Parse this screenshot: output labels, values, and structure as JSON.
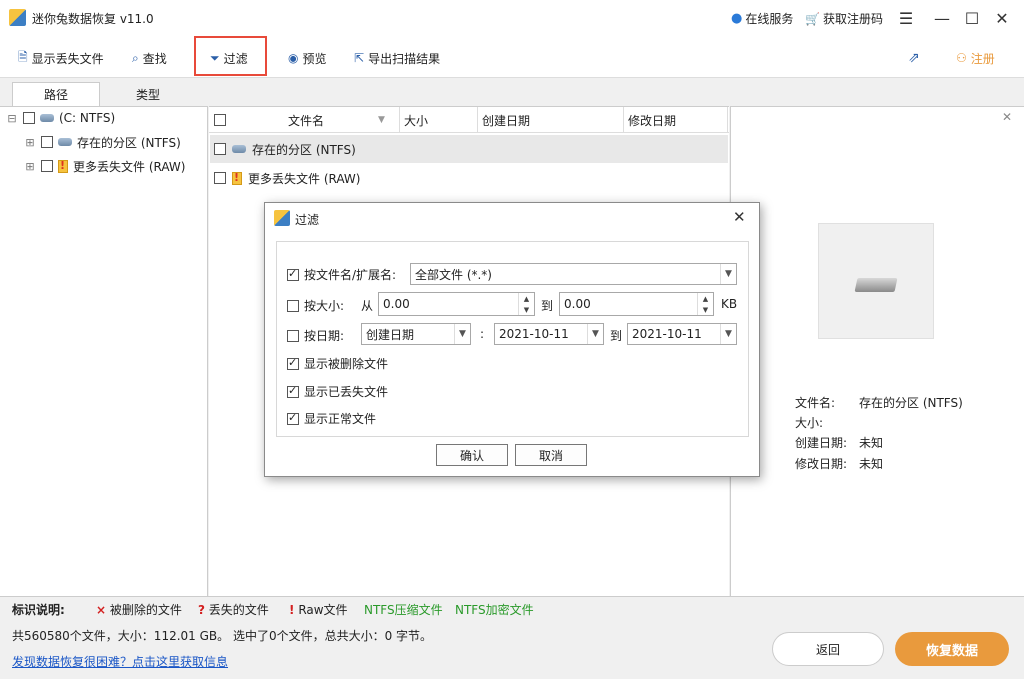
{
  "app": {
    "title": "迷你兔数据恢复 v11.0",
    "online_service": "在线服务",
    "get_code": "获取注册码"
  },
  "toolbar": {
    "show_lost": "显示丢失文件",
    "find": "查找",
    "filter": "过滤",
    "preview": "预览",
    "export": "导出扫描结果",
    "register": "注册"
  },
  "tabs": {
    "path": "路径",
    "type": "类型"
  },
  "tree": {
    "root": "(C: NTFS)",
    "items": [
      "存在的分区 (NTFS)",
      "更多丢失文件 (RAW)"
    ]
  },
  "columns": [
    "文件名",
    "大小",
    "创建日期",
    "修改日期"
  ],
  "files": [
    "存在的分区 (NTFS)",
    "更多丢失文件 (RAW)"
  ],
  "preview": {
    "name_label": "文件名:",
    "name_value": "存在的分区 (NTFS)",
    "size_label": "大小:",
    "created_label": "创建日期:",
    "created_value": "未知",
    "modified_label": "修改日期:",
    "modified_value": "未知"
  },
  "legend": {
    "title": "标识说明:",
    "deleted": "被删除的文件",
    "lost": "丢失的文件",
    "raw": "Raw文件",
    "compressed": "NTFS压缩文件",
    "encrypted": "NTFS加密文件"
  },
  "status": {
    "line": "共560580个文件，大小：112.01 GB。 选中了0个文件，总共大小：0 字节。",
    "help_link": "发现数据恢复很困难？点击这里获取信息"
  },
  "buttons": {
    "back": "返回",
    "recover": "恢复数据"
  },
  "dialog": {
    "title": "过滤",
    "by_name_label": "按文件名/扩展名:",
    "by_name_value": "全部文件 (*.*)",
    "by_size_label": "按大小:",
    "from": "从",
    "size_from": "0.00",
    "to": "到",
    "size_to": "0.00",
    "size_unit": "KB",
    "by_date_label": "按日期:",
    "date_type": "创建日期",
    "colon": ":",
    "date_from": "2021-10-11",
    "date_to": "2021-10-11",
    "show_deleted": "显示被删除文件",
    "show_lost": "显示已丢失文件",
    "show_normal": "显示正常文件",
    "ok": "确认",
    "cancel": "取消"
  },
  "colors": {
    "accent": "#e99a3d",
    "highlight": "#e84a3a",
    "link": "#1a56c6",
    "green": "#2a9a2a",
    "red": "#d32020"
  }
}
